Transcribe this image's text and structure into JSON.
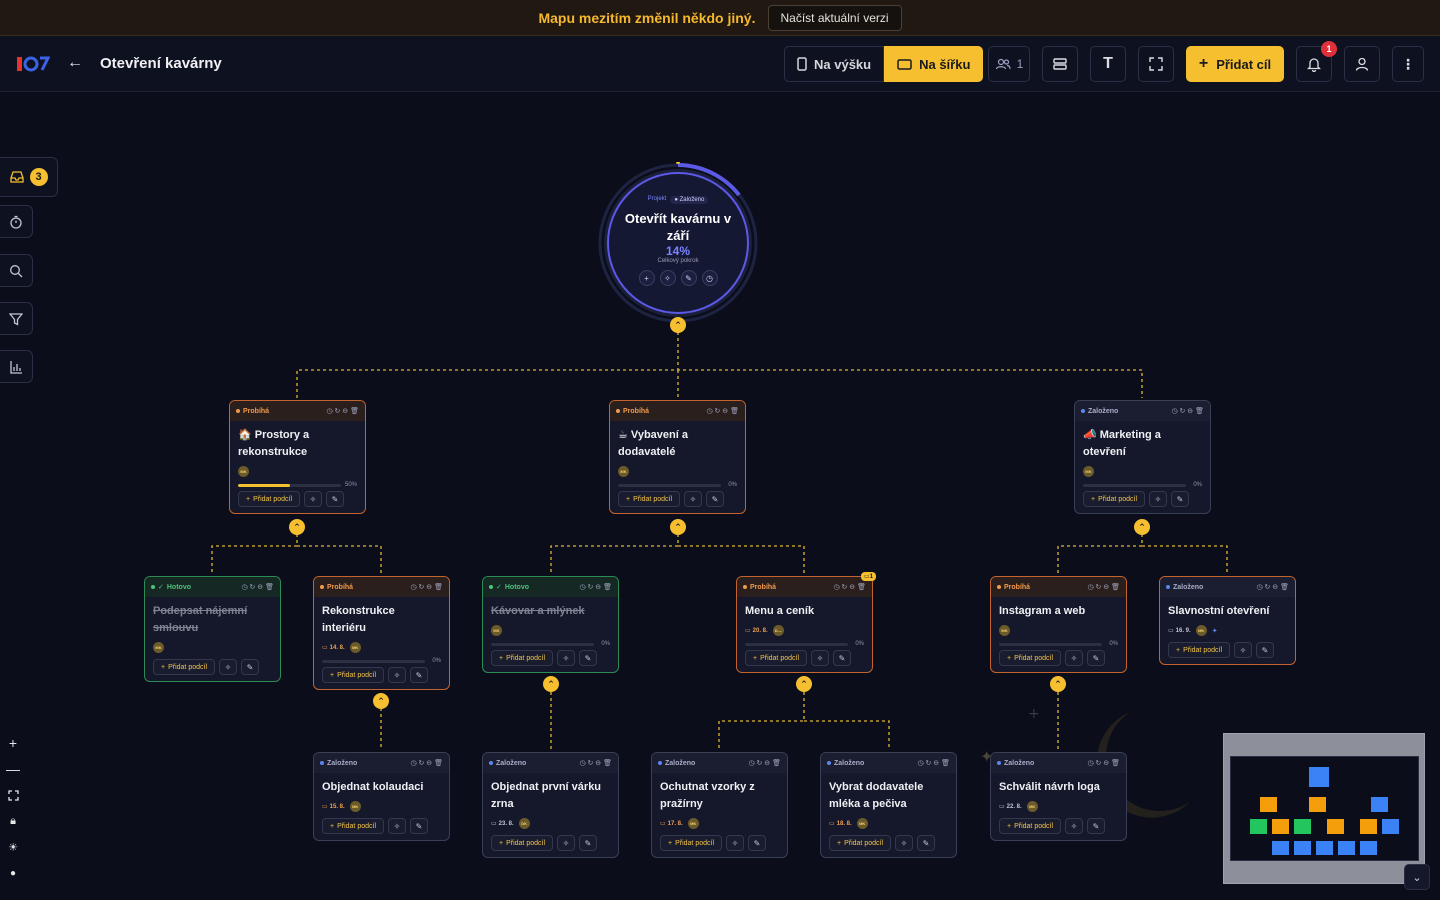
{
  "banner": {
    "message": "Mapu mezitím změnil někdo jiný.",
    "button": "Načíst aktuální verzi"
  },
  "topbar": {
    "title": "Otevření kavárny",
    "layout_vertical": "Na výšku",
    "layout_horizontal": "Na šířku",
    "users_count": "1",
    "add_goal": "Přidat cíl",
    "notifications": "1"
  },
  "sidebar": {
    "inbox_count": "3"
  },
  "colors": {
    "accent": "#f5bf2f",
    "probiha": "#c4632d",
    "hotovo": "#2a8c52",
    "zalozeno": "#3a3f58",
    "root": "#5b59e6"
  },
  "root": {
    "tag_project": "Projekt",
    "tag_state": "Založeno",
    "title": "Otevřít kavárnu v září",
    "progress": "14%",
    "progress_label": "Celkový pokrok"
  },
  "nodes": {
    "prostory": {
      "status": "Probíhá",
      "title": "🏠 Prostory a rekonstrukce",
      "avatar": "MK",
      "progress": "50%",
      "add": "Přidat podcíl"
    },
    "vybaveni": {
      "status": "Probíhá",
      "title": "☕ Vybavení a dodavatelé",
      "avatar": "MK",
      "progress": "0%",
      "add": "Přidat podcíl"
    },
    "marketing": {
      "status": "Založeno",
      "title": "📣 Marketing a otevření",
      "avatar": "MK",
      "progress": "0%",
      "add": "Přidat podcíl"
    },
    "najem": {
      "status": "Hotovo",
      "title": "Podepsat nájemní smlouvu",
      "avatar": "MK",
      "add": "Přidat podcíl"
    },
    "rekonstrukce": {
      "status": "Probíhá",
      "title": "Rekonstrukce interiéru",
      "date": "14. 8.",
      "avatar": "MK",
      "progress": "0%",
      "add": "Přidat podcíl"
    },
    "kavovar": {
      "status": "Hotovo",
      "title": "Kávovar a mlýnek",
      "avatar": "MK",
      "progress": "0%",
      "add": "Přidat podcíl"
    },
    "menu": {
      "status": "Probíhá",
      "title": "Menu a ceník",
      "date": "20. 8.",
      "avatar": "D—",
      "progress": "0%",
      "add": "Přidat podcíl",
      "comments": "1"
    },
    "instagram": {
      "status": "Probíhá",
      "title": "Instagram a web",
      "avatar": "MK",
      "progress": "0%",
      "add": "Přidat podcíl"
    },
    "slavnostni": {
      "status": "Založeno",
      "title": "Slavnostní otevření",
      "date": "16. 9.",
      "avatar": "MK",
      "add": "Přidat podcíl"
    },
    "kolaudace": {
      "status": "Založeno",
      "title": "Objednat kolaudaci",
      "date": "15. 8.",
      "avatar": "MK",
      "add": "Přidat podcíl"
    },
    "zrna": {
      "status": "Založeno",
      "title": "Objednat první várku zrna",
      "date": "23. 8.",
      "avatar": "DK",
      "add": "Přidat podcíl"
    },
    "vzorky": {
      "status": "Založeno",
      "title": "Ochutnat vzorky z pražírny",
      "date": "17. 8.",
      "avatar": "MK",
      "add": "Přidat podcíl"
    },
    "mleko": {
      "status": "Založeno",
      "title": "Vybrat dodavatele mléka a pečiva",
      "date": "18. 8.",
      "avatar": "MK",
      "add": "Přidat podcíl"
    },
    "logo": {
      "status": "Založeno",
      "title": "Schválit návrh loga",
      "date": "22. 8.",
      "avatar": "MK",
      "add": "Přidat podcíl"
    }
  }
}
